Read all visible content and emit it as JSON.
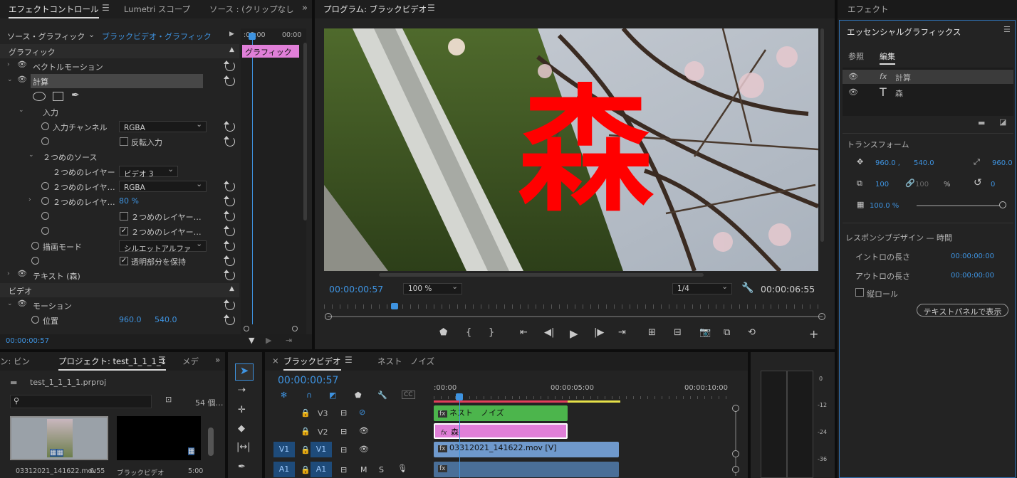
{
  "effect_controls": {
    "tabs": [
      "エフェクトコントロール",
      "Lumetri スコープ",
      "ソース : (クリップなし"
    ],
    "source_label": "ソース・グラフィック",
    "clip_label": "ブラックビデオ・グラフィック",
    "time_start": ":00:00",
    "time_mid": "00:00",
    "graphic_bar": "グラフィック",
    "section_graphic": "グラフィック",
    "vector_motion": "ベクトルモーション",
    "calc": "計算",
    "input_group": "入力",
    "input_channel_label": "入力チャンネル",
    "input_channel_value": "RGBA",
    "invert_input": "反転入力",
    "second_source": "２つめのソース",
    "second_layer_label": "２つめのレイヤー",
    "second_layer_value": "ビデオ 3",
    "second_layer_channel_label": "２つめのレイヤ…",
    "second_layer_channel_value": "RGBA",
    "second_layer_opacity_label": "２つめのレイヤ…",
    "second_layer_opacity_value": "80 %",
    "chk1_label": "２つめのレイヤー…",
    "chk2_label": "２つめのレイヤー…",
    "blend_mode_label": "描画モード",
    "blend_mode_value": "シルエットアルファ",
    "preserve_alpha": "透明部分を保持",
    "text_layer": "テキスト (森)",
    "section_video": "ビデオ",
    "motion": "モーション",
    "position": "位置",
    "pos_x": "960.0",
    "pos_y": "540.0",
    "timecode": "00:00:00:57"
  },
  "program": {
    "title": "プログラム: ブラックビデオ",
    "overlay_char": "森",
    "timecode": "00:00:00:57",
    "zoom": "100 %",
    "quality": "1/4",
    "duration": "00:00:06:55",
    "playhead_fraction": 0.135
  },
  "essential": {
    "effect_tab": "エフェクト",
    "title": "エッセンシャルグラフィックス",
    "tab_browse": "参照",
    "tab_edit": "編集",
    "layers": [
      {
        "icon": "fx",
        "name": "計算"
      },
      {
        "icon": "T",
        "name": "森"
      }
    ],
    "transform_title": "トランスフォーム",
    "pos_x": "960.0 ,",
    "pos_y": "540.0",
    "anchor": "960.0",
    "scale": "100",
    "scale2": "100",
    "pct": "%",
    "rotation": "0",
    "opacity": "100.0 %",
    "responsive_title": "レスポンシブデザイン — 時間",
    "intro_label": "イントロの長さ",
    "intro_value": "00:00:00:00",
    "outro_label": "アウトロの長さ",
    "outro_value": "00:00:00:00",
    "roll_label": "縦ロール",
    "text_panel_button": "テキストパネルで表示"
  },
  "project": {
    "tabs": [
      "ン: ビン",
      "プロジェクト: test_1_1_1_1",
      "メデ"
    ],
    "file": "test_1_1_1_1.prproj",
    "count": "54 個…",
    "items": [
      {
        "name": "03312021_141622.mov",
        "duration": "6:55"
      },
      {
        "name": "ブラックビデオ",
        "duration": "5:00"
      }
    ]
  },
  "timeline": {
    "tab": "ブラックビデオ",
    "tab2": "ネスト　ノイズ",
    "timecode": "00:00:00:57",
    "ruler": [
      ":00:00",
      "00:00:05:00",
      "00:00:10:00"
    ],
    "tracks": [
      {
        "name": "V3",
        "src": ""
      },
      {
        "name": "V2",
        "src": ""
      },
      {
        "name": "V1",
        "src": "V1"
      },
      {
        "name": "A1",
        "src": "A1"
      }
    ],
    "clips": [
      {
        "label": "ネスト　ノイズ",
        "color": "#4cb54c"
      },
      {
        "label": "森",
        "color": "#e07fd8"
      },
      {
        "label": "03312021_141622.mov [V]",
        "color": "#6f99cc"
      },
      {
        "label": "",
        "color": "#4a6f98"
      }
    ]
  },
  "meter": {
    "labels": [
      "0",
      "-12",
      "-24",
      "-36"
    ]
  },
  "colors": {
    "accent": "#3e93e0",
    "text_red": "#ff0000"
  }
}
